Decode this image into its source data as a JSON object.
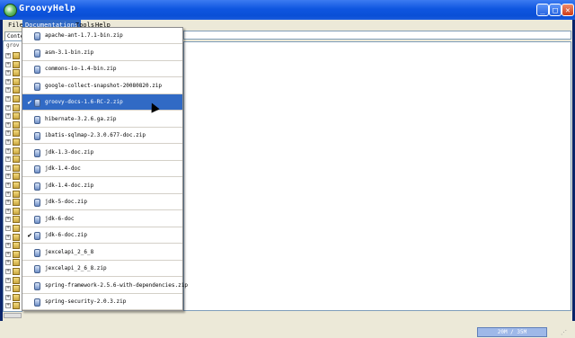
{
  "window": {
    "title": "GroovyHelp",
    "controls": {
      "minimize": "_",
      "maximize": "□",
      "close": "✕"
    }
  },
  "menubar": {
    "items": [
      {
        "label": "File",
        "active": false
      },
      {
        "label": "Documentations",
        "active": true
      },
      {
        "label": "Tools",
        "active": false
      },
      {
        "label": "Help",
        "active": false
      }
    ]
  },
  "tabs": {
    "contents_label": "Conte"
  },
  "search": {
    "placeholder": "grov"
  },
  "dropdown": {
    "items": [
      {
        "label": "apache-ant-1.7.1-bin.zip",
        "checked": false,
        "selected": false
      },
      {
        "label": "asm-3.1-bin.zip",
        "checked": false,
        "selected": false
      },
      {
        "label": "commons-io-1.4-bin.zip",
        "checked": false,
        "selected": false
      },
      {
        "label": "google-collect-snapshot-20080820.zip",
        "checked": false,
        "selected": false
      },
      {
        "label": "groovy-docs-1.6-RC-2.zip",
        "checked": true,
        "selected": true
      },
      {
        "label": "hibernate-3.2.6.ga.zip",
        "checked": false,
        "selected": false
      },
      {
        "label": "ibatis-sqlmap-2.3.0.677-doc.zip",
        "checked": false,
        "selected": false
      },
      {
        "label": "jdk-1.3-doc.zip",
        "checked": false,
        "selected": false
      },
      {
        "label": "jdk-1.4-doc",
        "checked": false,
        "selected": false
      },
      {
        "label": "jdk-1.4-doc.zip",
        "checked": false,
        "selected": false
      },
      {
        "label": "jdk-5-doc.zip",
        "checked": false,
        "selected": false
      },
      {
        "label": "jdk-6-doc",
        "checked": false,
        "selected": false
      },
      {
        "label": "jdk-6-doc.zip",
        "checked": true,
        "selected": false
      },
      {
        "label": "jexcelapi_2_6_8",
        "checked": false,
        "selected": false
      },
      {
        "label": "jexcelapi_2_6_8.zip",
        "checked": false,
        "selected": false
      },
      {
        "label": "spring-framework-2.5.6-with-dependencies.zip",
        "checked": false,
        "selected": false
      },
      {
        "label": "spring-security-2.0.3.zip",
        "checked": false,
        "selected": false
      }
    ]
  },
  "status": {
    "memory": "20M / 35M"
  }
}
